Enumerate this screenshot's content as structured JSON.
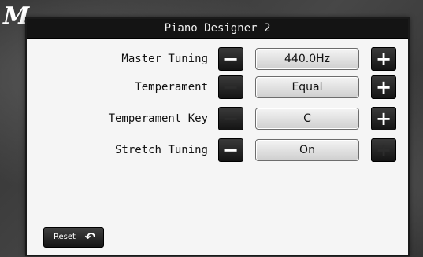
{
  "brand": {
    "logo_text": "M"
  },
  "dialog": {
    "title": "Piano Designer 2",
    "rows": [
      {
        "label": "Master Tuning",
        "value": "440.0Hz",
        "minus": "−",
        "plus": "+"
      },
      {
        "label": "Temperament",
        "value": "Equal",
        "minus": "−",
        "plus": "+"
      },
      {
        "label": "Temperament Key",
        "value": "C",
        "minus": "−",
        "plus": "+"
      },
      {
        "label": "Stretch Tuning",
        "value": "On",
        "minus": "−",
        "plus": "+"
      }
    ],
    "reset_label": "Reset",
    "reset_icon": "↶"
  },
  "colors": {
    "dialog_bg": "#f5f5f5",
    "titlebar_bg": "#141414",
    "button_bg": "#1e1e1e",
    "button_glyph": "#ffffff",
    "button_glyph_disabled": "#2c2c2c"
  },
  "icons": {
    "minus": "minus-icon",
    "plus": "plus-icon",
    "reset": "undo-arrow-icon"
  }
}
